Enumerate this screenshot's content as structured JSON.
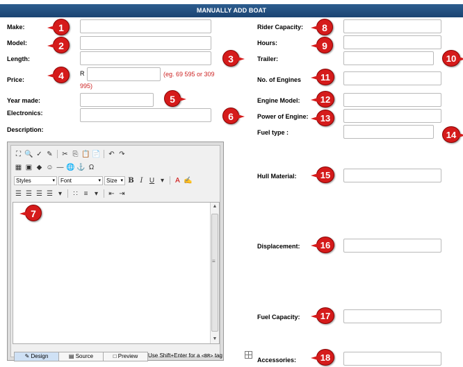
{
  "header": {
    "title": "MANUALLY ADD BOAT"
  },
  "left_fields": {
    "make": "Make:",
    "model": "Model:",
    "length": "Length:",
    "price": "Price:",
    "price_currency": "R",
    "price_hint_1": "(eg. 69 595 or 309",
    "price_hint_2": "995)",
    "year_made": "Year made:",
    "electronics": "Electronics:",
    "description": "Description:"
  },
  "right_fields": {
    "rider_capacity": "Rider Capacity:",
    "hours": "Hours:",
    "trailer": "Trailer:",
    "no_engines": "No. of Engines",
    "engine_model": "Engine Model:",
    "power_engine": "Power of Engine:",
    "fuel_type": "Fuel type :",
    "hull_material": "Hull Material:",
    "displacement": "Displacement:",
    "fuel_capacity": "Fuel Capacity:",
    "accessories": "Accessories:"
  },
  "markers": [
    "1",
    "2",
    "3",
    "4",
    "5",
    "6",
    "7",
    "8",
    "9",
    "10",
    "11",
    "12",
    "13",
    "14",
    "15",
    "16",
    "17",
    "18"
  ],
  "editor": {
    "style_select": "Styles",
    "font_select": "Font",
    "size_select": "Size",
    "tabs": [
      "Design",
      "Source",
      "Preview"
    ],
    "shift_hint_pre": "Use Shift+Enter for a",
    "shift_hint_tag": "<BR>",
    "shift_hint_post": "tag"
  },
  "colors": {
    "header_bg": "#1b4472",
    "marker_red": "#d51b1b",
    "hint_red": "#cc2222"
  }
}
